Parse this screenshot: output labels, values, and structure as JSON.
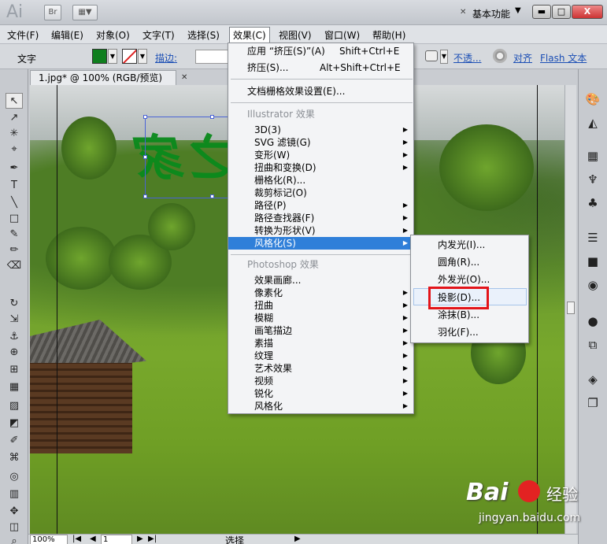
{
  "titlebar": {
    "logo": "Ai",
    "bridge_label": "Br",
    "workspace": "基本功能",
    "workspace_arrow": "▼",
    "layout_arrow": "▼",
    "close_glyph": "X",
    "min_glyph": "▬",
    "max_glyph": "□",
    "sep_glyph": "✕"
  },
  "menubar": [
    {
      "label": "文件(F)"
    },
    {
      "label": "编辑(E)"
    },
    {
      "label": "对象(O)"
    },
    {
      "label": "文字(T)"
    },
    {
      "label": "选择(S)"
    },
    {
      "label": "效果(C)"
    },
    {
      "label": "视图(V)"
    },
    {
      "label": "窗口(W)"
    },
    {
      "label": "帮助(H)"
    }
  ],
  "controlbar": {
    "label": "文字",
    "stroke_label": "描边:",
    "opacity_label": "不透...",
    "align_label": "对齐",
    "text_label": "Flash 文本",
    "fill_color": "#0f7f1e",
    "arrow": "▼"
  },
  "document": {
    "tab_title": "1.jpg* @ 100% (RGB/预览)",
    "close_glyph": "✕",
    "canvas_text": "绿色之家"
  },
  "statusbar": {
    "zoom": "100%",
    "page": "1",
    "status": "选择",
    "nav_first": "|◀",
    "nav_prev": "◀",
    "nav_next": "▶",
    "nav_last": "▶|"
  },
  "effect_menu": {
    "apply_label": "应用 “挤压(S)”(A)",
    "apply_shortcut": "Shift+Ctrl+E",
    "squeeze_label": "挤压(S)...",
    "squeeze_shortcut": "Alt+Shift+Ctrl+E",
    "raster_settings": "文档栅格效果设置(E)...",
    "illustrator_header": "Illustrator 效果",
    "illustrator_items": [
      "3D(3)",
      "SVG 滤镜(G)",
      "变形(W)",
      "扭曲和变换(D)",
      "栅格化(R)...",
      "裁剪标记(O)",
      "路径(P)",
      "路径查找器(F)",
      "转换为形状(V)",
      "风格化(S)"
    ],
    "photoshop_header": "Photoshop 效果",
    "photoshop_items": [
      "效果画廊...",
      "像素化",
      "扭曲",
      "模糊",
      "画笔描边",
      "素描",
      "纹理",
      "艺术效果",
      "视频",
      "锐化",
      "风格化"
    ],
    "arrow": "▶"
  },
  "stylize_submenu": {
    "items": [
      "内发光(I)...",
      "圆角(R)...",
      "外发光(O)...",
      "投影(D)...",
      "涂抹(B)...",
      "羽化(F)..."
    ]
  },
  "watermark": {
    "logo": "Bai",
    "brand": "经验",
    "url": "jingyan.baidu.com"
  },
  "tools": [
    "↖",
    "↗",
    "✳",
    "⌖",
    "✒",
    "T",
    "╲",
    "□",
    "✎",
    "✏",
    "⌫",
    "↻",
    "⇲",
    "⚓",
    "⊕",
    "⊞",
    "▦",
    "▨",
    "◩",
    "✐",
    "⌘",
    "◎",
    "▥",
    "✥",
    "◫",
    "⌕"
  ],
  "right_icons": [
    "🎨",
    "◭",
    "▦",
    "♆",
    "♣",
    "☰",
    "■",
    "◉",
    "●",
    "⧉",
    "◈",
    "❐"
  ]
}
